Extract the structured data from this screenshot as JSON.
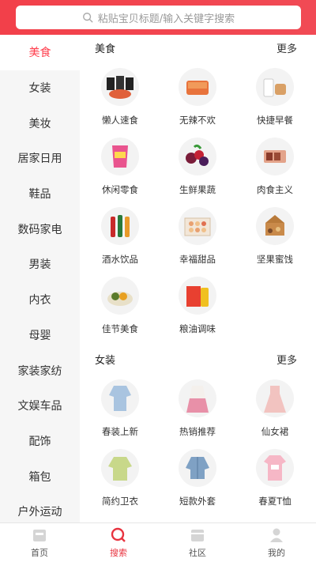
{
  "search": {
    "placeholder": "粘贴宝贝标题/输入关键字搜索"
  },
  "sidebar": {
    "items": [
      {
        "label": "美食",
        "active": true
      },
      {
        "label": "女装"
      },
      {
        "label": "美妆"
      },
      {
        "label": "居家日用"
      },
      {
        "label": "鞋品"
      },
      {
        "label": "数码家电"
      },
      {
        "label": "男装"
      },
      {
        "label": "内衣"
      },
      {
        "label": "母婴"
      },
      {
        "label": "家装家纺"
      },
      {
        "label": "文娱车品"
      },
      {
        "label": "配饰"
      },
      {
        "label": "箱包"
      },
      {
        "label": "户外运动"
      }
    ]
  },
  "sections": [
    {
      "title": "美食",
      "more": "更多",
      "items": [
        {
          "label": "懒人速食"
        },
        {
          "label": "无辣不欢"
        },
        {
          "label": "快捷早餐"
        },
        {
          "label": "休闲零食"
        },
        {
          "label": "生鲜果蔬"
        },
        {
          "label": "肉食主义"
        },
        {
          "label": "酒水饮品"
        },
        {
          "label": "幸福甜品"
        },
        {
          "label": "坚果蜜饯"
        },
        {
          "label": "佳节美食"
        },
        {
          "label": "粮油调味"
        }
      ]
    },
    {
      "title": "女装",
      "more": "更多",
      "items": [
        {
          "label": "春装上新"
        },
        {
          "label": "热销推荐"
        },
        {
          "label": "仙女裙"
        },
        {
          "label": "简约卫衣"
        },
        {
          "label": "短款外套"
        },
        {
          "label": "春夏T恤"
        }
      ]
    }
  ],
  "tabbar": {
    "items": [
      {
        "label": "首页",
        "icon": "home-icon"
      },
      {
        "label": "搜索",
        "icon": "search-icon",
        "active": true
      },
      {
        "label": "社区",
        "icon": "community-icon"
      },
      {
        "label": "我的",
        "icon": "profile-icon"
      }
    ]
  },
  "colors": {
    "accent": "#e8333f",
    "header": "#f2404a"
  }
}
